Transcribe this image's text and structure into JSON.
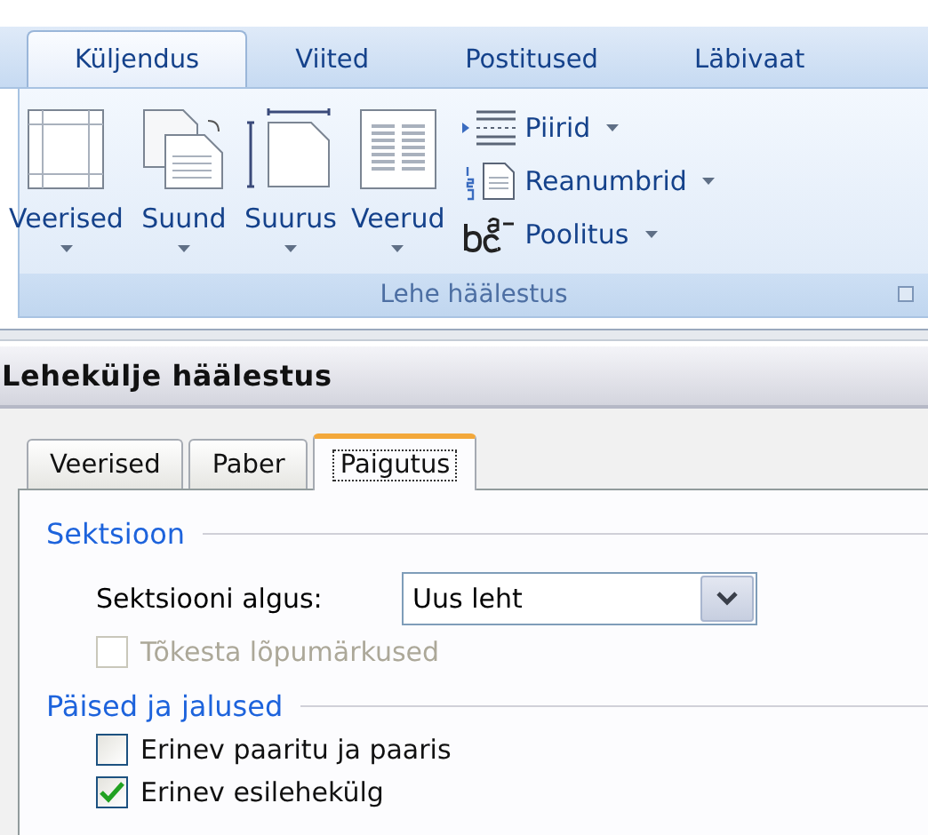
{
  "ribbon": {
    "tabs": [
      {
        "label": "Küljendus",
        "selected": true
      },
      {
        "label": "Viited",
        "selected": false
      },
      {
        "label": "Postitused",
        "selected": false
      },
      {
        "label": "Läbivaat",
        "selected": false
      }
    ],
    "group": {
      "label": "Lehe häälestus",
      "large_buttons": [
        {
          "kind": "margins",
          "label": "Veerised"
        },
        {
          "kind": "orientation",
          "label": "Suund"
        },
        {
          "kind": "size",
          "label": "Suurus"
        },
        {
          "kind": "columns",
          "label": "Veerud"
        }
      ],
      "small_buttons": [
        {
          "kind": "breaks",
          "label": "Piirid"
        },
        {
          "kind": "line-numbers",
          "label": "Reanumbrid"
        },
        {
          "kind": "hyphenation",
          "label": "Poolitus"
        }
      ]
    }
  },
  "dialog": {
    "title": "Lehekülje häälestus",
    "tabs": [
      {
        "label": "Veerised",
        "selected": false
      },
      {
        "label": "Paber",
        "selected": false
      },
      {
        "label": "Paigutus",
        "selected": true
      }
    ],
    "sections": [
      {
        "heading": "Sektsioon",
        "items": [
          {
            "kind": "dropdown",
            "label": "Sektsiooni algus:",
            "value": "Uus leht"
          },
          {
            "kind": "checkbox",
            "label": "Tõkesta lõpumärkused",
            "checked": false,
            "disabled": true
          }
        ]
      },
      {
        "heading": "Päised ja jalused",
        "items": [
          {
            "kind": "checkbox",
            "label": "Erinev paaritu ja paaris",
            "checked": false,
            "disabled": false
          },
          {
            "kind": "checkbox",
            "label": "Erinev esilehekülg",
            "checked": true,
            "disabled": false
          }
        ]
      }
    ]
  }
}
